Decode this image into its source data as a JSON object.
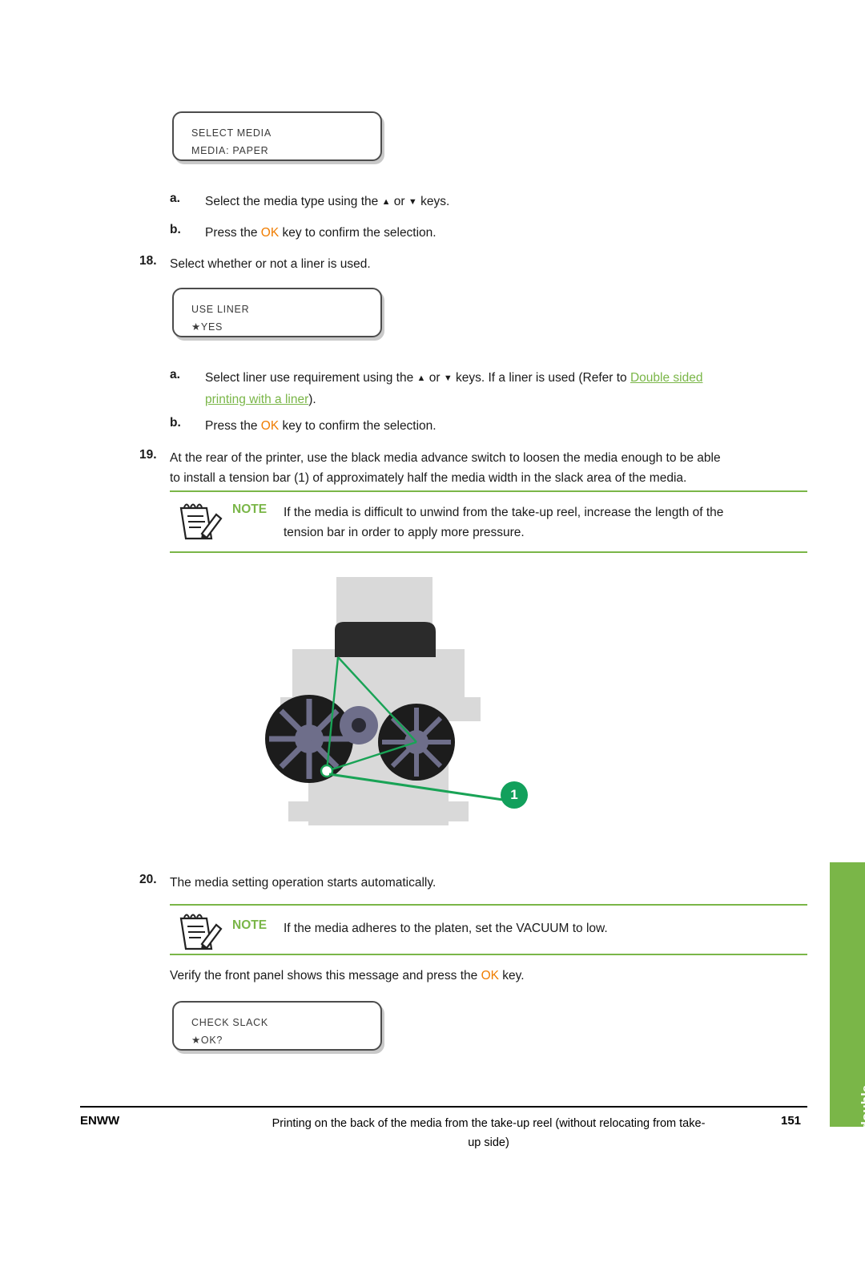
{
  "document": {
    "panels": {
      "select_media": {
        "line1": "SELECT MEDIA",
        "line2": "MEDIA: PAPER"
      },
      "use_liner": {
        "line1": "USE LINER",
        "line2": "★YES"
      },
      "check_slack": {
        "line1": "CHECK SLACK",
        "line2": "★OK?"
      }
    },
    "steps": [
      {
        "sub": "a.",
        "text_pre": "Select the media type using the ",
        "text_mid": " or ",
        "text_post": " keys."
      },
      {
        "sub": "b.",
        "text_pre": "Press the ",
        "key": "OK",
        "text_post": " key to confirm the selection."
      },
      {
        "number": "18.",
        "text": "Select whether or not a liner is used."
      },
      {
        "sub": "a.",
        "text_pre": "Select liner use requirement using the ",
        "text_mid": " or ",
        "text_post": " keys. If a liner is used (Refer to ",
        "link1": "Double sided",
        "link2": "printing with a liner",
        "text_tail": ")."
      },
      {
        "sub": "b.",
        "text_pre": "Press the ",
        "key": "OK",
        "text_post": " key to confirm the selection."
      },
      {
        "number": "19.",
        "line1": "At the rear of the printer, use the black media advance switch to loosen the media enough to be able",
        "line2": "to install a tension bar (1) of approximately half the media width in the slack area of the media."
      },
      {
        "number": "20.",
        "text": "The media setting operation starts automatically."
      }
    ],
    "notes": [
      {
        "label": "NOTE",
        "line1": "If the media is difficult to unwind from the take-up reel, increase the length of the",
        "line2": "tension bar in order to apply more pressure."
      },
      {
        "label": "NOTE",
        "line1": "If the media adheres to the platen, set the VACUUM to low.",
        "line2": ""
      }
    ],
    "verify_text_pre": "Verify the front panel shows this message and press the ",
    "verify_key": "OK",
    "verify_text_post": " key.",
    "figure": {
      "callout_1": "1"
    },
    "side_tab": {
      "line1": "How do I perform double-sided",
      "line2": "printing"
    },
    "footer": {
      "left": "ENWW",
      "center_line1": "Printing on the back of the media from the take-up reel (without relocating from take-",
      "center_line2": "up side)",
      "right": "151"
    },
    "colors": {
      "accent_green": "#7ab648",
      "key_orange": "#f07d00",
      "callout_green": "#12a05c"
    }
  }
}
